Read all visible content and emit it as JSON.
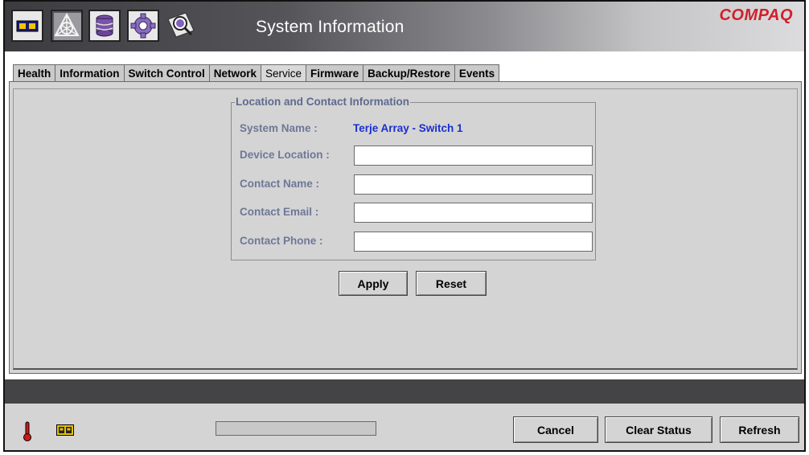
{
  "header": {
    "title": "System Information",
    "brand": "COMPAQ",
    "tools": [
      {
        "icon": "switch-icon"
      },
      {
        "icon": "fabric-icon"
      },
      {
        "icon": "storage-icon"
      },
      {
        "icon": "settings-icon"
      },
      {
        "icon": "system-info-icon"
      }
    ]
  },
  "tabs": [
    {
      "label": "Health"
    },
    {
      "label": "Information"
    },
    {
      "label": "Switch Control"
    },
    {
      "label": "Network"
    },
    {
      "label": "Service",
      "active": true
    },
    {
      "label": "Firmware"
    },
    {
      "label": "Backup/Restore"
    },
    {
      "label": "Events"
    }
  ],
  "location_group": {
    "title": "Location and Contact Information",
    "system_name": {
      "label": "System Name :",
      "value": "Terje Array - Switch 1"
    },
    "device_location": {
      "label": "Device Location :",
      "value": ""
    },
    "contact_name": {
      "label": "Contact Name :",
      "value": ""
    },
    "contact_email": {
      "label": "Contact Email :",
      "value": ""
    },
    "contact_phone": {
      "label": "Contact Phone :",
      "value": ""
    }
  },
  "form_buttons": {
    "apply": "Apply",
    "reset": "Reset"
  },
  "footer": {
    "temperature_icon": "thermometer-icon",
    "switch_icon": "switch-status-icon",
    "progress": 0,
    "cancel": "Cancel",
    "clear_status": "Clear Status",
    "refresh": "Refresh"
  },
  "colors": {
    "brand_red": "#d0202a",
    "value_blue": "#1a2fd0",
    "label_slate": "#6e7898",
    "panel_gray": "#d4d4d4"
  }
}
